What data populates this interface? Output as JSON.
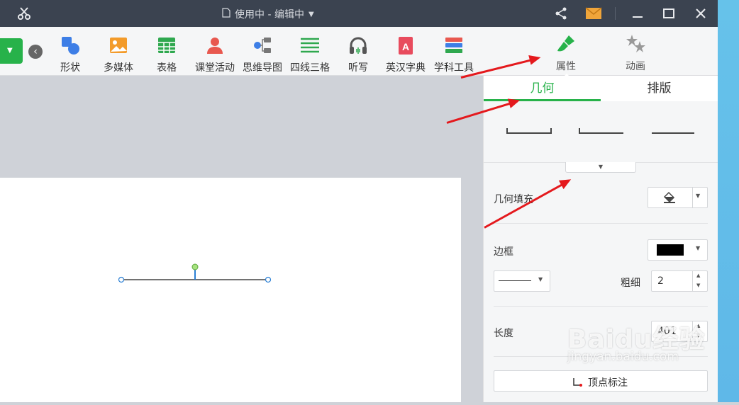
{
  "titlebar": {
    "doc_title": "使用中 - 编辑中",
    "icons": [
      "scissors-icon",
      "share-icon",
      "mail-icon",
      "minimize-icon",
      "maximize-icon",
      "close-icon"
    ]
  },
  "toolbar": {
    "items": [
      {
        "label": "形状",
        "icon": "shape-icon",
        "color": "#3d7ee6"
      },
      {
        "label": "多媒体",
        "icon": "media-icon",
        "color": "#f39b2a"
      },
      {
        "label": "表格",
        "icon": "table-icon",
        "color": "#2fa84f"
      },
      {
        "label": "课堂活动",
        "icon": "activity-icon",
        "color": "#e8584f"
      },
      {
        "label": "思维导图",
        "icon": "mindmap-icon",
        "color": "#3d7ee6"
      },
      {
        "label": "四线三格",
        "icon": "fourline-icon",
        "color": "#2fa84f"
      },
      {
        "label": "听写",
        "icon": "headphones-icon",
        "color": "#555555"
      },
      {
        "label": "英汉字典",
        "icon": "dictionary-icon",
        "color": "#e84b5d"
      },
      {
        "label": "学科工具",
        "icon": "subject-tools-icon",
        "color": "#3d7ee6"
      }
    ],
    "properties_label": "属性",
    "animation_label": "动画"
  },
  "panel": {
    "tabs": [
      {
        "label": "几何",
        "active": true
      },
      {
        "label": "排版",
        "active": false
      }
    ],
    "fill_label": "几何填充",
    "border_label": "边框",
    "border_color": "#000000",
    "thickness_label": "粗细",
    "thickness_value": "2",
    "length_label": "长度",
    "length_value": "401",
    "vertex_label": "顶点标注"
  },
  "colors": {
    "accent": "#27b24a",
    "titlebar": "#3b4350",
    "arrow": "#e4191d"
  },
  "watermark": {
    "line1": "Baidu经验",
    "line2": "jingyan.baidu.com"
  }
}
